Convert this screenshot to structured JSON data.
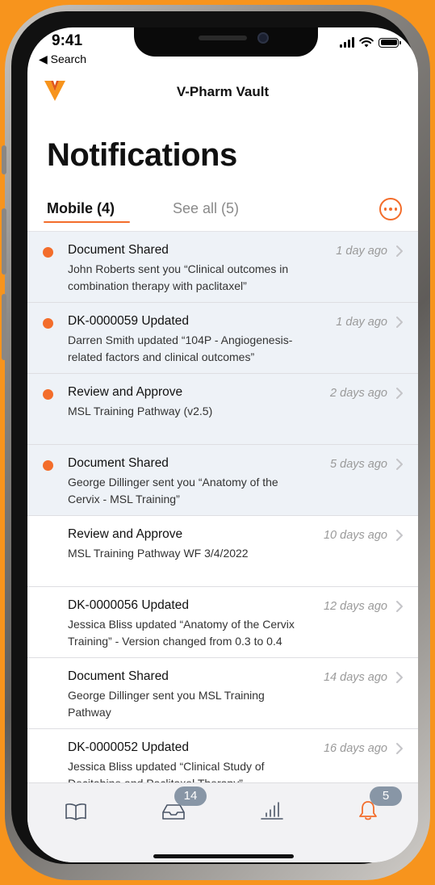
{
  "status_bar": {
    "time": "9:41",
    "back_label": "◀ Search"
  },
  "app": {
    "title": "V-Pharm Vault",
    "brand_color": "#F7941D",
    "accent_color": "#F36D2B"
  },
  "page": {
    "title": "Notifications"
  },
  "tabs": [
    {
      "label": "Mobile (4)",
      "active": true
    },
    {
      "label": "See all (5)",
      "active": false
    }
  ],
  "notifications": [
    {
      "title": "Document Shared",
      "description": "John Roberts sent you “Clinical outcomes in combination therapy with paclitaxel”",
      "time": "1 day ago",
      "unread": true
    },
    {
      "title": "DK-0000059 Updated",
      "description": "Darren Smith updated “104P - Angiogenesis-related factors and clinical outcomes”",
      "time": "1 day ago",
      "unread": true
    },
    {
      "title": "Review and Approve",
      "description": "MSL Training Pathway (v2.5)",
      "time": "2 days ago",
      "unread": true
    },
    {
      "title": "Document Shared",
      "description": "George Dillinger sent you “Anatomy of the Cervix - MSL Training”",
      "time": "5 days ago",
      "unread": true
    },
    {
      "title": "Review and Approve",
      "description": "MSL Training Pathway WF 3/4/2022",
      "time": "10 days ago",
      "unread": false
    },
    {
      "title": "DK-0000056 Updated",
      "description": "Jessica Bliss updated “Anatomy of the Cervix Training” - Version changed from 0.3 to 0.4",
      "time": "12 days ago",
      "unread": false
    },
    {
      "title": "Document Shared",
      "description": "George Dillinger sent you MSL Training Pathway",
      "time": "14 days ago",
      "unread": false
    },
    {
      "title": "DK-0000052 Updated",
      "description": "Jessica Bliss updated “Clinical Study of Decitabine and Paclitaxel Therapy”",
      "time": "16 days ago",
      "unread": false
    }
  ],
  "tab_bar": {
    "inbox_badge": "14",
    "notifications_badge": "5",
    "items": [
      {
        "icon": "book-icon"
      },
      {
        "icon": "inbox-icon"
      },
      {
        "icon": "chart-icon"
      },
      {
        "icon": "bell-icon"
      }
    ]
  }
}
